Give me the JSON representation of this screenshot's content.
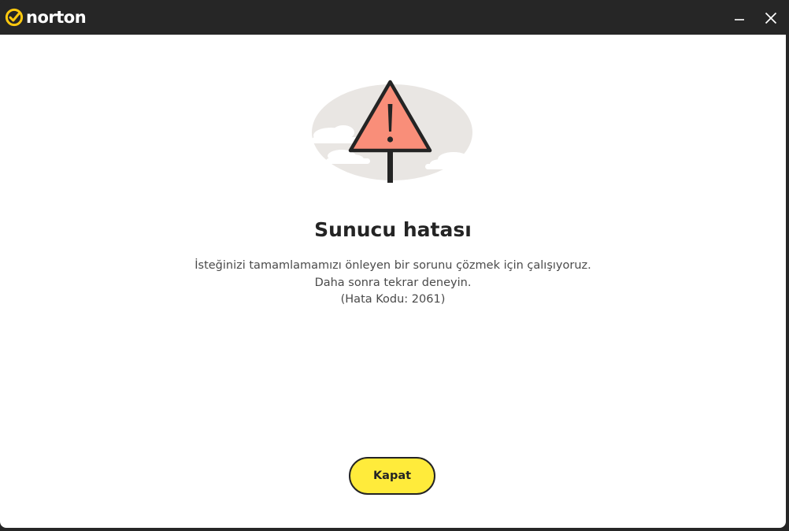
{
  "app": {
    "brand": "norton",
    "brand_color": "#ffc90e",
    "titlebar_color": "#262626"
  },
  "window_controls": {
    "minimize_icon": "minimize-icon",
    "close_icon": "close-icon"
  },
  "error": {
    "illustration": "warning-sign-icon",
    "sign_color": "#f98e79",
    "title": "Sunucu hatası",
    "lines": [
      "İsteğinizi tamamlamamızı önleyen bir sorunu çözmek için çalışıyoruz.",
      "Daha sonra tekrar deneyin.",
      "(Hata Kodu: 2061)"
    ]
  },
  "actions": {
    "close_label": "Kapat",
    "close_color": "#ffeb3b"
  }
}
